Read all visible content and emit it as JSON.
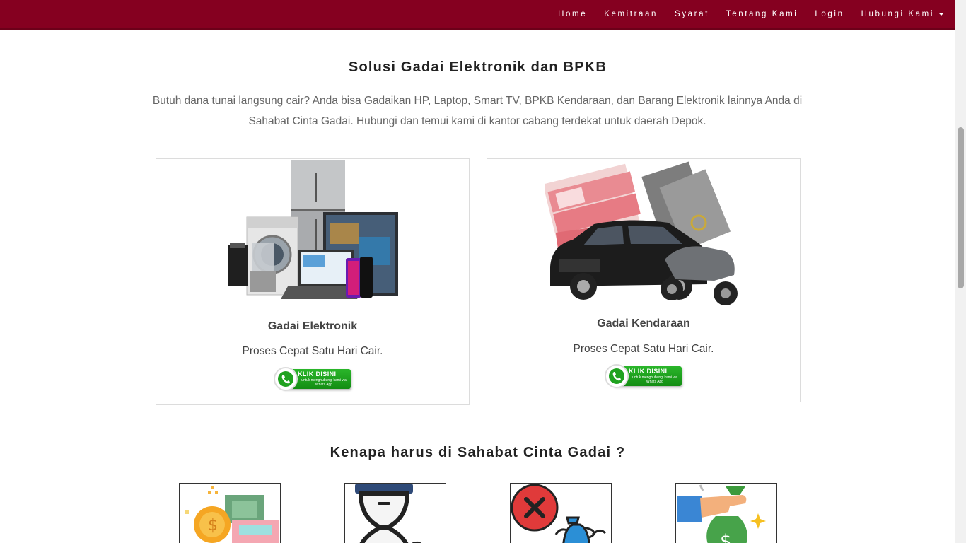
{
  "nav": {
    "items": [
      "Home",
      "Kemitraan",
      "Syarat",
      "Tentang Kami",
      "Login",
      "Hubungi Kami"
    ]
  },
  "hero": {
    "title": "Solusi Gadai Elektronik dan BPKB",
    "intro": "Butuh dana tunai langsung cair? Anda bisa Gadaikan HP, Laptop, Smart TV, BPKB Kendaraan, dan Barang Elektronik lainnya Anda di Sahabat Cinta Gadai. Hubungi dan temui kami di kantor cabang terdekat untuk daerah Depok."
  },
  "cards": [
    {
      "title": "Gadai Elektronik",
      "subtitle": "Proses Cepat Satu Hari Cair."
    },
    {
      "title": "Gadai Kendaraan",
      "subtitle": "Proses Cepat Satu Hari Cair."
    }
  ],
  "wa_button": {
    "main": "KLIK DISINI",
    "small": "untuk menghubungi kami via Whats App"
  },
  "why": {
    "title": "Kenapa harus di Sahabat Cinta Gadai ?"
  },
  "colors": {
    "navbar": "#850020",
    "whatsapp": "#1fa21f"
  }
}
